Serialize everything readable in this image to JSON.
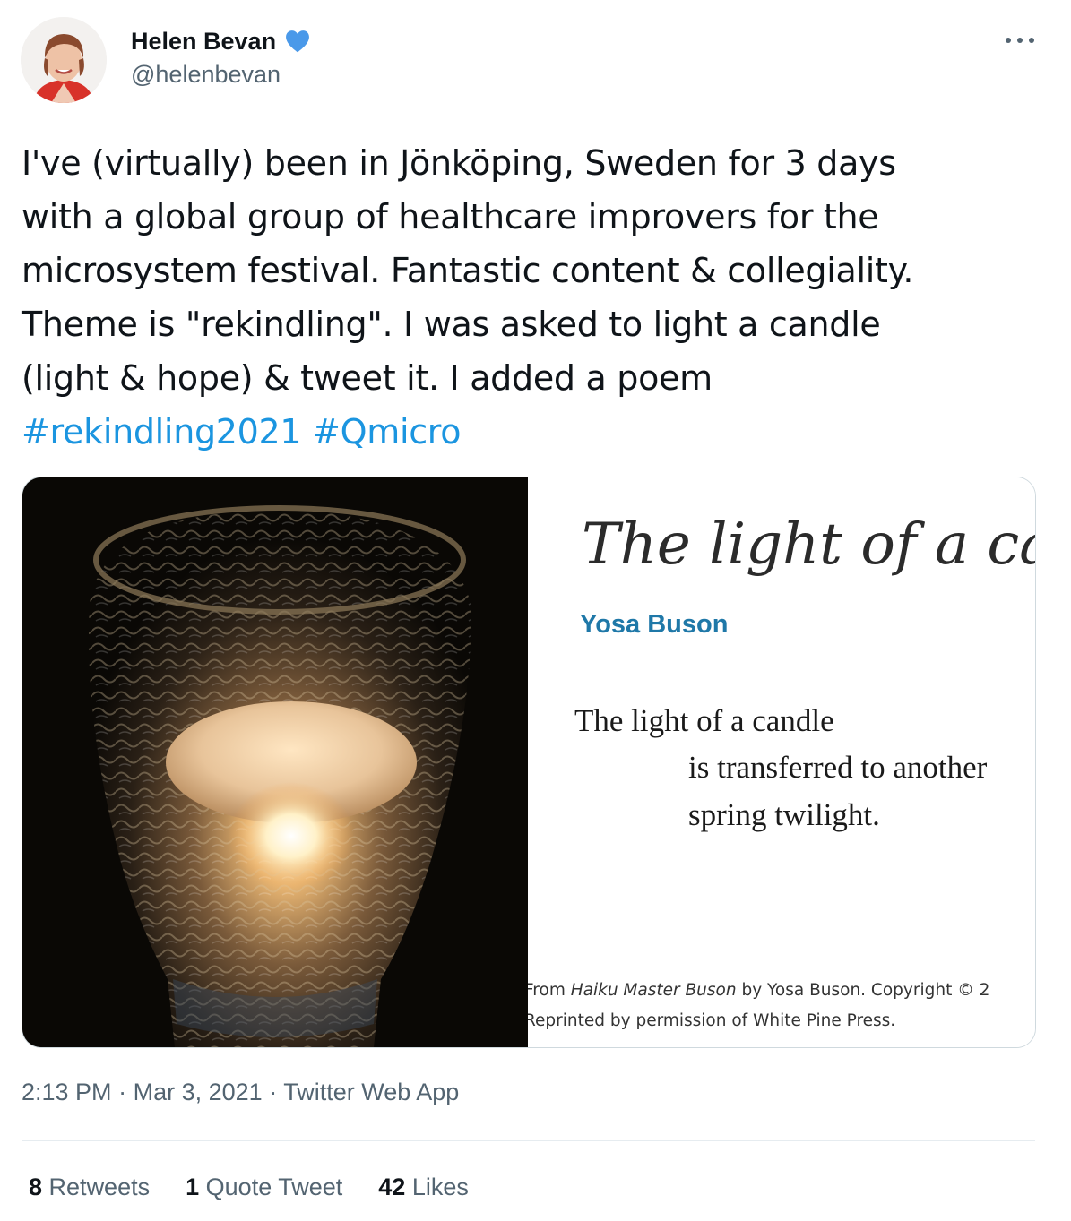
{
  "author": {
    "display_name": "Helen Bevan",
    "handle": "@helenbevan",
    "verified": true,
    "avatar": "avatar-photo"
  },
  "tweet": {
    "lines": [
      "I've (virtually) been in Jönköping, Sweden for 3 days",
      "with a global group of healthcare improvers for the",
      "microsystem festival. Fantastic content & collegiality.",
      "Theme is \"rekindling\". I was asked to light a candle",
      "(light & hope) & tweet it. I added a poem"
    ],
    "hashtags": [
      "#rekindling2021",
      "#Qmicro"
    ]
  },
  "media": {
    "photo_subject": "lit candle in textured glass holder",
    "poem": {
      "title": "The light of a canc",
      "author": "Yosa Buson",
      "lines": [
        "The light of a candle",
        "is transferred to another",
        "spring twilight."
      ],
      "credit_line1_prefix": "From ",
      "credit_book": "Haiku Master Buson",
      "credit_line1_suffix": " by Yosa Buson. Copyright © 2",
      "credit_line2": "Reprinted by permission of White Pine Press."
    }
  },
  "meta": {
    "time": "2:13 PM",
    "separator": "·",
    "date": "Mar 3, 2021",
    "source": "Twitter Web App"
  },
  "stats": {
    "retweets_count": "8",
    "retweets_label": "Retweets",
    "quotes_count": "1",
    "quotes_label": "Quote Tweet",
    "likes_count": "42",
    "likes_label": "Likes"
  },
  "colors": {
    "link": "#1b95e0",
    "verified_badge": "#4a99e9",
    "secondary_text": "#536471",
    "poem_author": "#1f78a8"
  }
}
